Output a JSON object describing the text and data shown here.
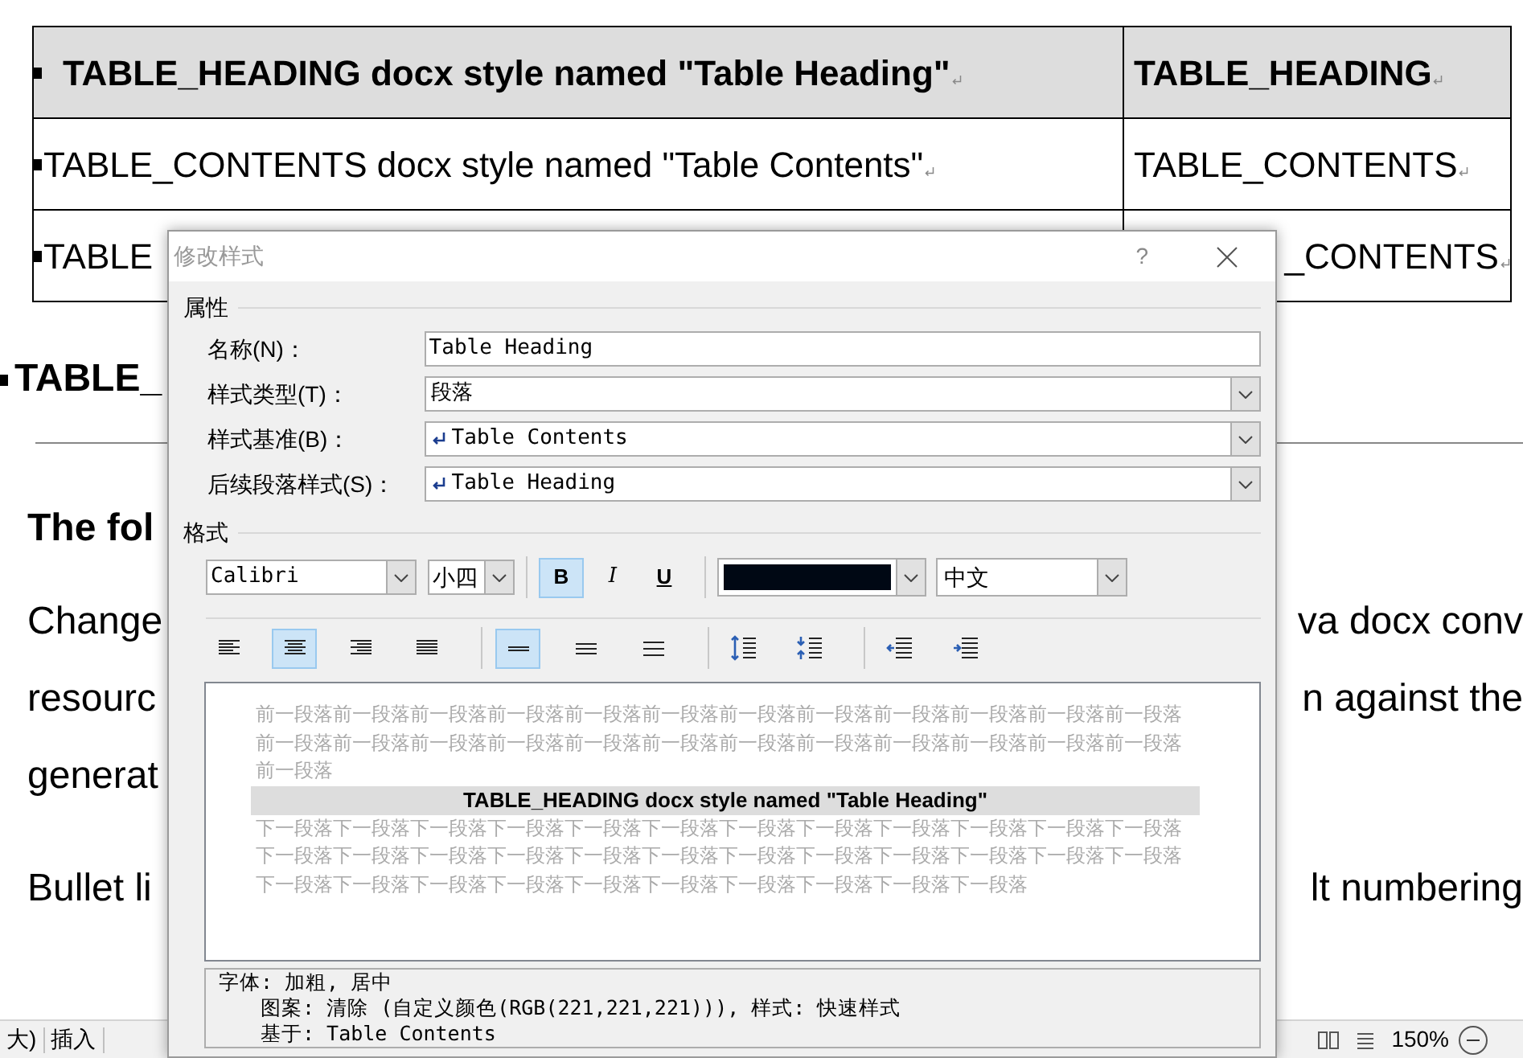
{
  "document": {
    "table": {
      "rows": [
        {
          "kind": "heading",
          "cells": [
            "TABLE_HEADING docx style named \"Table Heading\"",
            "TABLE_HEADING"
          ]
        },
        {
          "kind": "contents",
          "cells": [
            "TABLE_CONTENTS docx style named \"Table Contents\"",
            "TABLE_CONTENTS"
          ]
        },
        {
          "kind": "contents",
          "cells": [
            "TABLE",
            "_CONTENTS"
          ]
        }
      ]
    },
    "heading_fragment": "TABLE_",
    "subheading_fragment": "The fol",
    "lines": [
      {
        "left": "Change",
        "right": "va docx conv"
      },
      {
        "left": "resourc",
        "right": "n against the"
      },
      {
        "left": "generat"
      },
      {
        "left": "Bullet li",
        "right": "lt numbering"
      }
    ]
  },
  "status_bar": {
    "left": [
      "大)",
      "插入"
    ],
    "zoom": "150%"
  },
  "dialog": {
    "title": "修改样式",
    "help": "?",
    "properties": {
      "title": "属性",
      "rows": [
        {
          "kind": "text",
          "label": "名称(N)：",
          "value": "Table Heading"
        },
        {
          "kind": "select",
          "label": "样式类型(T)：",
          "value": "段落"
        },
        {
          "kind": "select",
          "label": "样式基准(B)：",
          "value": "Table Contents",
          "para_mark": true
        },
        {
          "kind": "select",
          "label": "后续段落样式(S)：",
          "value": "Table Heading",
          "para_mark": true
        }
      ]
    },
    "format": {
      "title": "格式",
      "font": "Calibri",
      "size": "小四",
      "styles": [
        {
          "kind": "bold",
          "label": "B",
          "selected": true
        },
        {
          "kind": "italic",
          "label": "I",
          "selected": false
        },
        {
          "kind": "underline",
          "label": "U",
          "selected": false
        }
      ],
      "color": "#000814",
      "language": "中文",
      "alignment": [
        {
          "kind": "left",
          "selected": false
        },
        {
          "kind": "center",
          "selected": true
        },
        {
          "kind": "right",
          "selected": false
        },
        {
          "kind": "justify",
          "selected": false
        }
      ],
      "spacing": [
        {
          "kind": "single",
          "selected": true
        },
        {
          "kind": "onehalf",
          "selected": false
        },
        {
          "kind": "double",
          "selected": false
        }
      ],
      "paragraph": [
        {
          "kind": "space-increase"
        },
        {
          "kind": "space-decrease"
        },
        {
          "kind": "indent-decrease"
        },
        {
          "kind": "indent-increase"
        }
      ]
    },
    "preview": {
      "before": "前一段落前一段落前一段落前一段落前一段落前一段落前一段落前一段落前一段落前一段落前一段落前一段落前一段落前一段落前一段落前一段落前一段落前一段落前一段落前一段落前一段落前一段落前一段落前一段落前一段落",
      "sample": "TABLE_HEADING docx style named \"Table Heading\"",
      "after": "下一段落下一段落下一段落下一段落下一段落下一段落下一段落下一段落下一段落下一段落下一段落下一段落下一段落下一段落下一段落下一段落下一段落下一段落下一段落下一段落下一段落下一段落下一段落下一段落下一段落下一段落下一段落下一段落下一段落下一段落下一段落下一段落下一段落下一段落"
    },
    "description": [
      "字体: 加粗, 居中",
      "图案: 清除 (自定义颜色(RGB(221,221,221))), 样式: 快速样式",
      "基于: Table Contents"
    ]
  }
}
